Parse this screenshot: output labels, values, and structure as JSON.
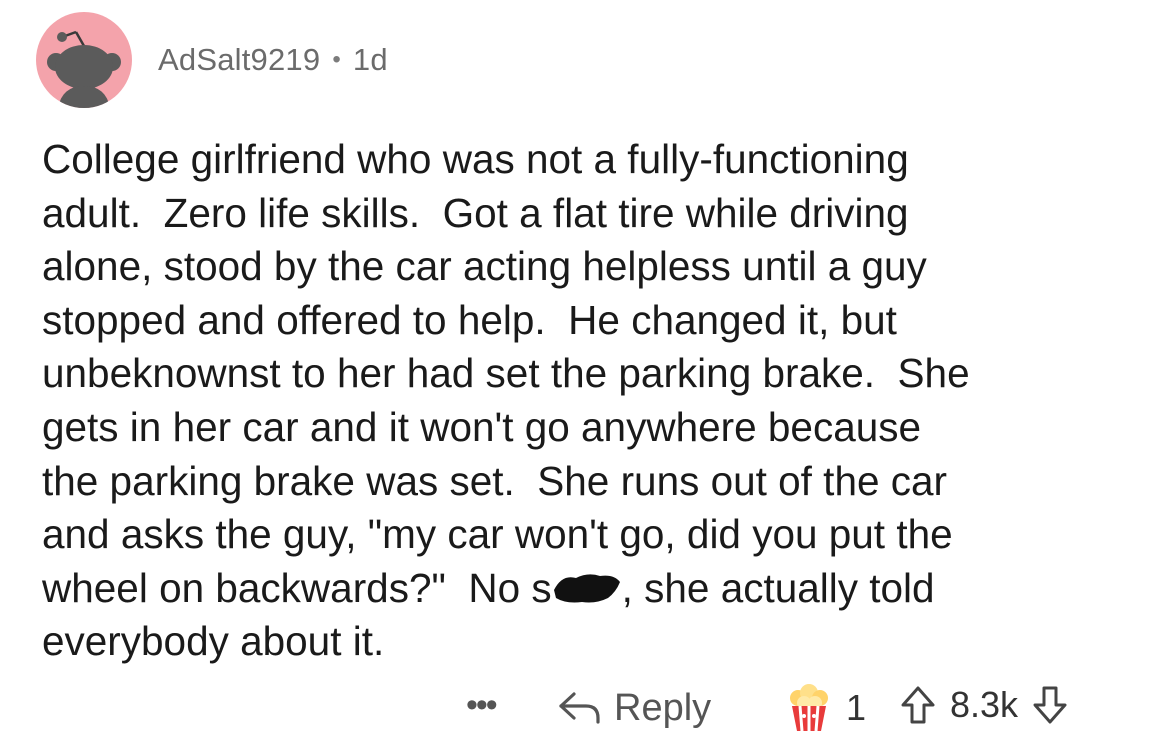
{
  "comment": {
    "author": "AdSalt9219",
    "separator": "•",
    "age": "1d",
    "body_lines": [
      "College girlfriend who was not a fully-functioning",
      "adult.  Zero life skills.  Got a flat tire while driving",
      "alone, stood by the car acting helpless until a guy",
      "stopped and offered to help.  He changed it, but",
      "unbeknownst to her had set the parking brake.  She",
      "gets in her car and it won't go anywhere because",
      "the parking brake was set.  She runs out of the car",
      "and asks the guy, \"my car won't go, did you put the"
    ],
    "line9_before": "wheel on backwards?\"  No s",
    "line9_after": ", she actually told",
    "line10": "everybody about it."
  },
  "actions": {
    "more_label": "•••",
    "reply_label": "Reply",
    "award_count": "1",
    "score": "8.3k"
  },
  "icons": {
    "avatar": "snoo-avatar-icon",
    "reply": "reply-arrow-icon",
    "award": "popcorn-award-icon",
    "upvote": "upvote-arrow-icon",
    "downvote": "downvote-arrow-icon"
  },
  "colors": {
    "avatar_bg": "#f4a3ab",
    "meta_text": "#6b6b6b"
  }
}
